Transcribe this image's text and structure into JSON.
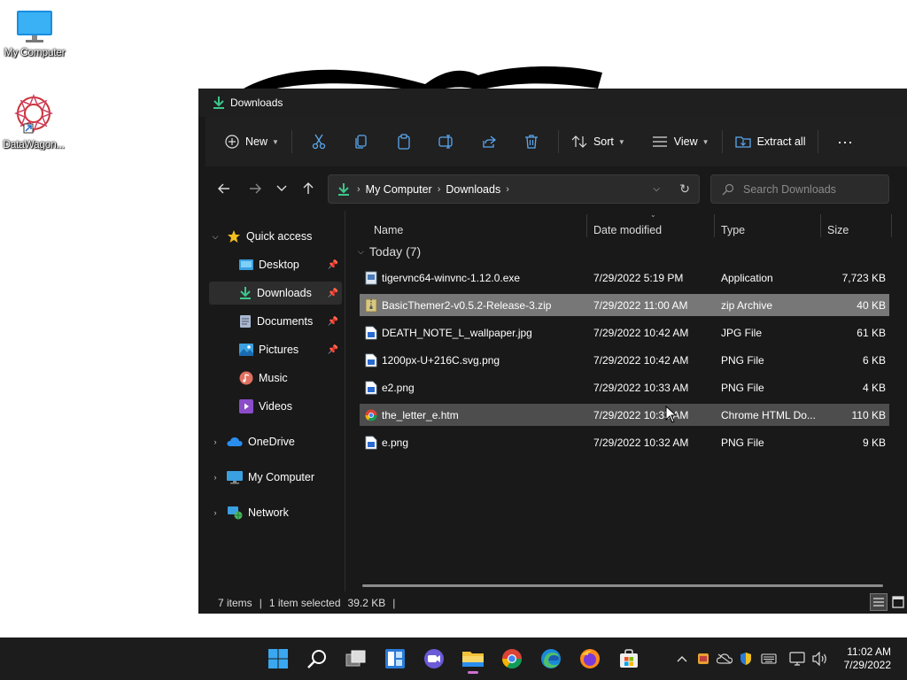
{
  "desktop": {
    "icons": [
      {
        "label": "My Computer",
        "icon": "monitor-icon"
      },
      {
        "label": "DataWagon...",
        "icon": "datawagon-shortcut-icon"
      }
    ]
  },
  "window": {
    "title": "Downloads",
    "commandbar": {
      "new_label": "New",
      "sort_label": "Sort",
      "view_label": "View",
      "extract_label": "Extract all",
      "more_label": "..."
    },
    "address": {
      "crumbs": [
        "My Computer",
        "Downloads"
      ],
      "search_placeholder": "Search Downloads"
    },
    "navpane": {
      "quick_access": "Quick access",
      "items": [
        {
          "label": "Desktop",
          "pinned": true
        },
        {
          "label": "Downloads",
          "pinned": true,
          "selected": true
        },
        {
          "label": "Documents",
          "pinned": true
        },
        {
          "label": "Pictures",
          "pinned": true
        },
        {
          "label": "Music",
          "pinned": false
        },
        {
          "label": "Videos",
          "pinned": false
        }
      ],
      "onedrive": "OneDrive",
      "mycomputer": "My Computer",
      "network": "Network"
    },
    "columns": {
      "name": "Name",
      "date": "Date modified",
      "type": "Type",
      "size": "Size"
    },
    "group_label": "Today (7)",
    "files": [
      {
        "name": "tigervnc64-winvnc-1.12.0.exe",
        "date": "7/29/2022 5:19 PM",
        "type": "Application",
        "size": "7,723 KB"
      },
      {
        "name": "BasicThemer2-v0.5.2-Release-3.zip",
        "date": "7/29/2022 11:00 AM",
        "type": "zip Archive",
        "size": "40 KB"
      },
      {
        "name": "DEATH_NOTE_L_wallpaper.jpg",
        "date": "7/29/2022 10:42 AM",
        "type": "JPG File",
        "size": "61 KB"
      },
      {
        "name": "1200px-U+216C.svg.png",
        "date": "7/29/2022 10:42 AM",
        "type": "PNG File",
        "size": "6 KB"
      },
      {
        "name": "e2.png",
        "date": "7/29/2022 10:33 AM",
        "type": "PNG File",
        "size": "4 KB"
      },
      {
        "name": "the_letter_e.htm",
        "date": "7/29/2022 10:33 AM",
        "type": "Chrome HTML Do...",
        "size": "110 KB"
      },
      {
        "name": "e.png",
        "date": "7/29/2022 10:32 AM",
        "type": "PNG File",
        "size": "9 KB"
      }
    ],
    "status": {
      "items": "7 items",
      "selected": "1 item selected",
      "selected_size": "39.2 KB",
      "separator": "|"
    }
  },
  "taskbar": {
    "time": "11:02 AM",
    "date": "7/29/2022"
  }
}
